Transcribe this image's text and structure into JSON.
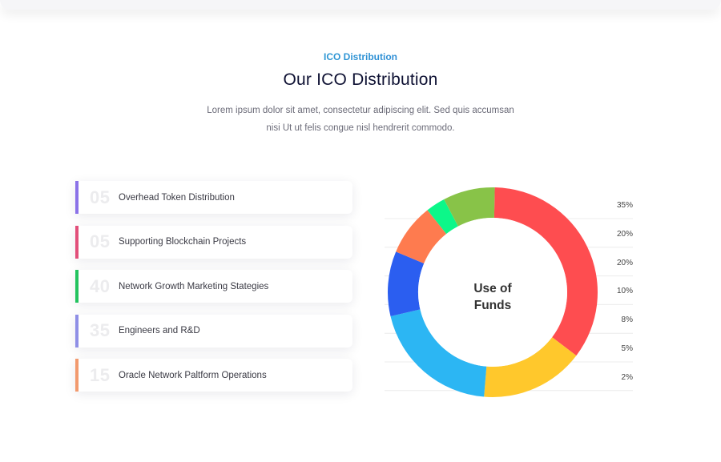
{
  "header": {
    "eyebrow": "ICO Distribution",
    "title": "Our ICO Distribution",
    "description": "Lorem ipsum dolor sit amet, consectetur adipiscing elit. Sed quis accumsan nisi Ut ut felis congue nisl hendrerit commodo."
  },
  "distribution": [
    {
      "number": "05",
      "label": "Overhead Token Distribution",
      "color": "#8b72e8"
    },
    {
      "number": "05",
      "label": "Supporting Blockchain Projects",
      "color": "#e24f7a"
    },
    {
      "number": "40",
      "label": "Network Growth Marketing Stategies",
      "color": "#22c35e"
    },
    {
      "number": "35",
      "label": "Engineers and R&D",
      "color": "#8f8fe6"
    },
    {
      "number": "15",
      "label": "Oracle Network Paltform Operations",
      "color": "#f29a6e"
    }
  ],
  "chart_data": {
    "type": "pie",
    "title": "Use of Funds",
    "slices": [
      {
        "value": 35,
        "color": "#fe4d50"
      },
      {
        "value": 16,
        "color": "#ffc82c"
      },
      {
        "value": 20,
        "color": "#2cb6f3"
      },
      {
        "value": 10,
        "color": "#2b5ef0"
      },
      {
        "value": 8,
        "color": "#fe7b4f"
      },
      {
        "value": 3,
        "color": "#0cf789"
      },
      {
        "value": 8,
        "color": "#88c348"
      }
    ],
    "scale_labels": [
      "35%",
      "20%",
      "20%",
      "10%",
      "8%",
      "5%",
      "2%"
    ]
  }
}
